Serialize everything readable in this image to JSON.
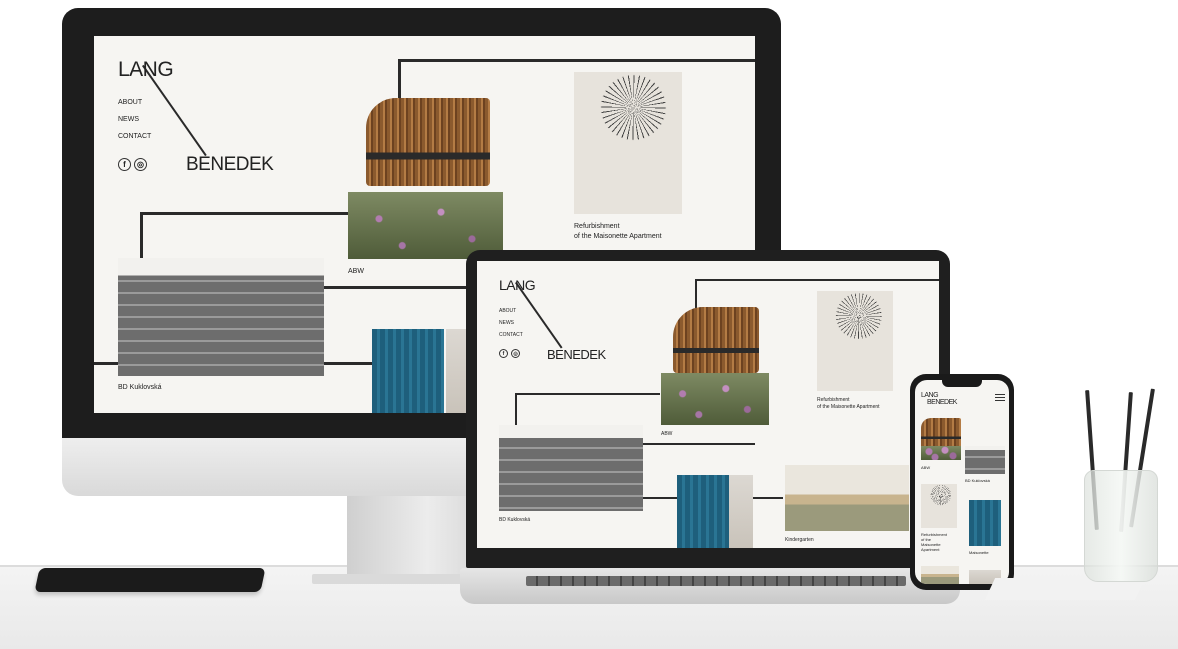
{
  "brand": {
    "lang": "LANG",
    "benedek": "BENEDEK",
    "phone_logo_line1": "LANG",
    "phone_logo_line2": "BENEDEK"
  },
  "nav": {
    "about": "ABOUT",
    "news": "NEWS",
    "contact": "CONTACT"
  },
  "social": {
    "facebook": "f",
    "instagram": "◎"
  },
  "projects": {
    "abw": "ABW",
    "refurb_line1": "Refurbishment",
    "refurb_line2": "of the Maisonette Apartment",
    "bd": "BD Kuklovská",
    "kindergarten": "Kindergarten",
    "phone_refurb_l1": "Refurbishment",
    "phone_refurb_l2": "of the",
    "phone_refurb_l3": "Maisonette",
    "phone_refurb_l4": "Apartment",
    "phone_maisonette": "Maisonette"
  },
  "colors": {
    "screen_bg": "#f6f5f2",
    "line": "#2a2a2a",
    "accent_blue": "#1e5f7c",
    "wood": "#8b5a2e"
  }
}
